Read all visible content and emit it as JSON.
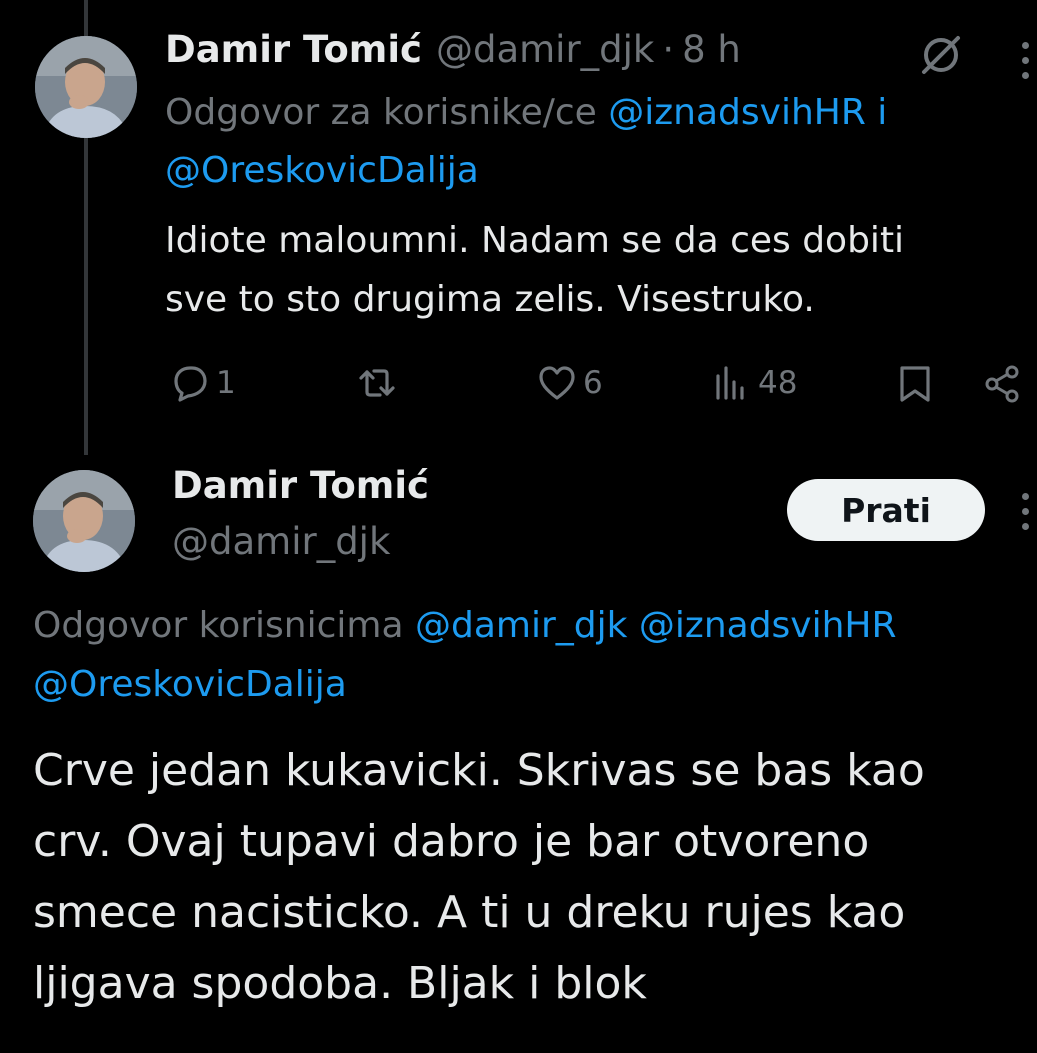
{
  "tweet1": {
    "name": "Damir Tomić",
    "handle": "@damir_djk",
    "separator": "·",
    "time": "8 h",
    "reply_prefix": "Odgovor za korisnike/ce",
    "reply_mention1": "@iznadsvihHR",
    "reply_joiner": "i",
    "reply_mention2": "@OreskovicDalija",
    "text_line1": "Idiote maloumni. Nadam se da ces dobiti",
    "text_line2": "sve to sto drugima zelis. Visestruko.",
    "replies": "1",
    "likes": "6",
    "views": "48"
  },
  "tweet2": {
    "name": "Damir Tomić",
    "handle": "@damir_djk",
    "follow_label": "Prati",
    "reply_prefix": "Odgovor korisnicima",
    "reply_mention1": "@damir_djk",
    "reply_mention2": "@iznadsvihHR",
    "reply_mention3": "@OreskovicDalija",
    "text_line1": "Crve jedan kukavicki. Skrivas se bas kao",
    "text_line2": "crv. Ovaj tupavi dabro je bar otvoreno",
    "text_line3": "smece nacisticko. A ti u dreku rujes kao",
    "text_line4": "ljigava spodoba. Bljak i blok"
  },
  "icons": [
    "avatar",
    "grok-icon",
    "more-icon",
    "reply-icon",
    "retweet-icon",
    "like-icon",
    "views-icon",
    "bookmark-icon",
    "share-icon"
  ],
  "colors": {
    "background": "#000000",
    "text": "#e7e9ea",
    "muted": "#71767b",
    "link": "#1d9bf0",
    "button": "#eff3f4"
  }
}
